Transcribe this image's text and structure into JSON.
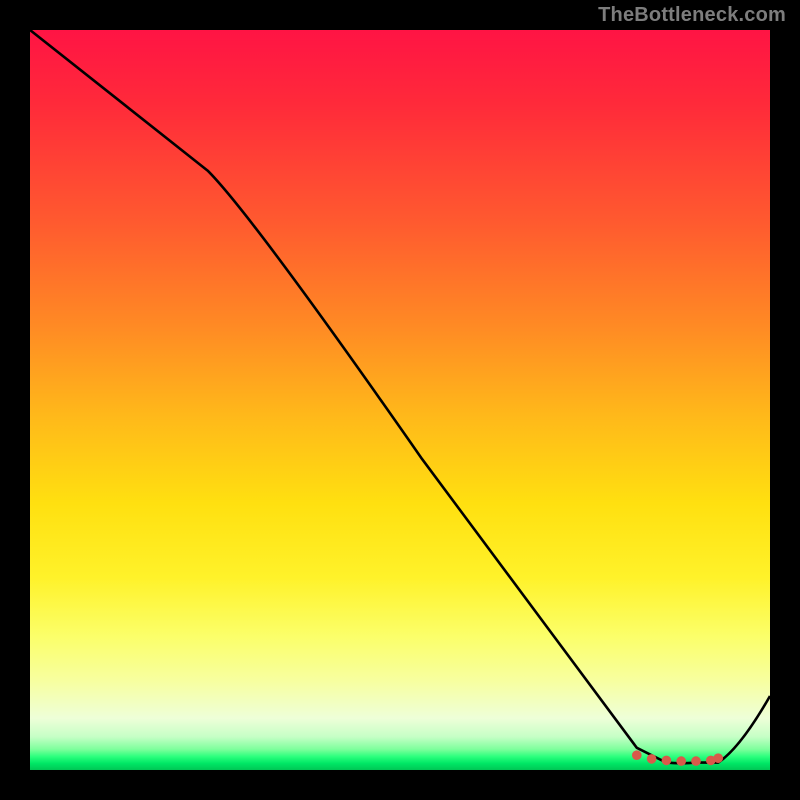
{
  "watermark": "TheBottleneck.com",
  "chart_data": {
    "type": "line",
    "title": "",
    "xlabel": "",
    "ylabel": "",
    "xlim": [
      0,
      100
    ],
    "ylim": [
      0,
      100
    ],
    "grid": false,
    "legend": false,
    "series": [
      {
        "name": "curve",
        "x": [
          0,
          24,
          82,
          86,
          90,
          93,
          100
        ],
        "values": [
          100,
          81,
          3,
          1,
          1,
          1,
          10
        ]
      }
    ],
    "markers": {
      "name": "minimum-band",
      "x": [
        82,
        84,
        86,
        88,
        90,
        92,
        93
      ],
      "values": [
        2.0,
        1.5,
        1.3,
        1.2,
        1.2,
        1.3,
        1.6
      ],
      "color": "#d85a4a"
    },
    "background": {
      "type": "vertical-gradient",
      "stops": [
        {
          "pct": 0,
          "color": "#ff1444"
        },
        {
          "pct": 26,
          "color": "#ff5a2f"
        },
        {
          "pct": 52,
          "color": "#ffb81a"
        },
        {
          "pct": 74,
          "color": "#fff22a"
        },
        {
          "pct": 93,
          "color": "#eeffd8"
        },
        {
          "pct": 100,
          "color": "#00c755"
        }
      ]
    }
  }
}
